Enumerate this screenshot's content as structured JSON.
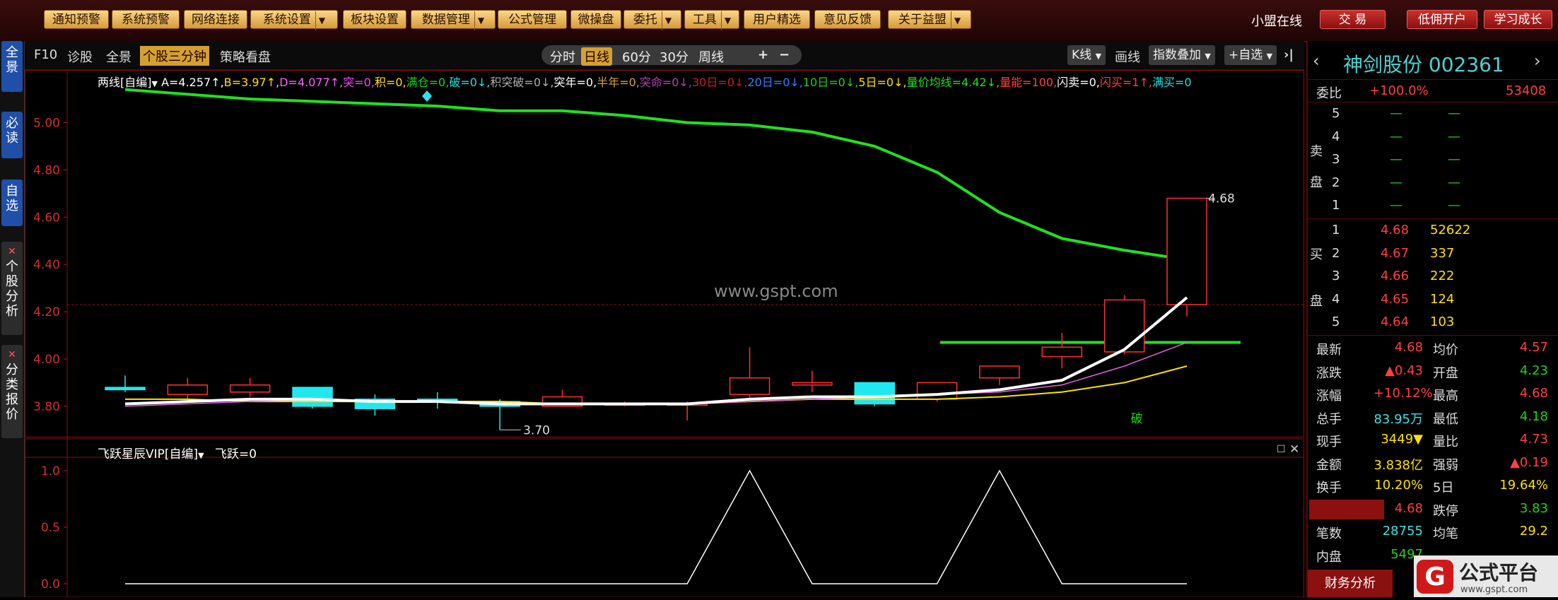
{
  "toolbar": {
    "buttons": [
      {
        "label": "通知预警",
        "dropdown": false
      },
      {
        "label": "系统预警",
        "dropdown": false
      },
      {
        "label": "网络连接",
        "dropdown": false
      },
      {
        "label": "系统设置",
        "dropdown": true
      },
      {
        "label": "板块设置",
        "dropdown": false
      },
      {
        "label": "数据管理",
        "dropdown": true
      },
      {
        "label": "公式管理",
        "dropdown": false
      },
      {
        "label": "微操盘",
        "dropdown": false
      },
      {
        "label": "委托",
        "dropdown": true
      },
      {
        "label": "工具",
        "dropdown": true
      },
      {
        "label": "用户精选",
        "dropdown": false
      },
      {
        "label": "意见反馈",
        "dropdown": false
      },
      {
        "label": "关于益盟",
        "dropdown": true
      }
    ],
    "online_label": "小盟在线",
    "right_buttons": [
      "交 易",
      "低佣开户",
      "学习成长"
    ]
  },
  "left_tabs": [
    "全景",
    "必读",
    "自选",
    "个股分析",
    "分类报价"
  ],
  "chart_toolbar": {
    "left_items": [
      "F10",
      "诊股",
      "全景",
      "个股三分钟",
      "策略看盘"
    ],
    "periods": [
      "分时",
      "日线",
      "60分",
      "30分",
      "周线"
    ],
    "zoom": [
      "+",
      "−"
    ],
    "right_items": [
      "K线",
      "画线",
      "指数叠加",
      "+自选"
    ],
    "close_label": "›|"
  },
  "indicator_main": {
    "name": "两线[自编]",
    "parts": [
      {
        "t": "A=4.257↑,",
        "c": "#ffffff"
      },
      {
        "t": "B=3.97↑,",
        "c": "#ffe000"
      },
      {
        "t": "D=4.077↑,",
        "c": "#ff60ff"
      },
      {
        "t": "突=0,",
        "c": "#ff40ff"
      },
      {
        "t": "积=0,",
        "c": "#ffe000"
      },
      {
        "t": "满仓=0,",
        "c": "#20d020"
      },
      {
        "t": "破=0↓,",
        "c": "#20e0e0"
      },
      {
        "t": "积突破=0↓,",
        "c": "#aaaaaa"
      },
      {
        "t": "突年=0,",
        "c": "#ffffff"
      },
      {
        "t": "半年=0,",
        "c": "#d0a040"
      },
      {
        "t": "突命=0↓,",
        "c": "#b040b0"
      },
      {
        "t": "30日=0↓,",
        "c": "#c02020"
      },
      {
        "t": "20日=0↓,",
        "c": "#3080ff"
      },
      {
        "t": "10日=0↓,",
        "c": "#20d020"
      },
      {
        "t": "5日=0↓,",
        "c": "#ffe000"
      },
      {
        "t": "量价均线=4.42↓,",
        "c": "#20e020"
      },
      {
        "t": "量能=100,",
        "c": "#ff4040"
      },
      {
        "t": "闪卖=0,",
        "c": "#ffffff"
      },
      {
        "t": "闪买=1↑,",
        "c": "#ff4040"
      },
      {
        "t": "满买=0",
        "c": "#20e0e0"
      }
    ]
  },
  "indicator_sub": {
    "name": "飞跃星辰VIP[自编]",
    "value": "飞跃=0"
  },
  "watermark": "www.gspt.com",
  "chart_data": {
    "type": "candlestick",
    "y_ticks": [
      "5.00",
      "4.80",
      "4.60",
      "4.40",
      "4.20",
      "4.00",
      "3.80"
    ],
    "ylim": [
      3.68,
      5.16
    ],
    "label_high": "4.68",
    "label_low": "3.70",
    "marker_label": "破",
    "candles": [
      {
        "o": 3.88,
        "h": 3.93,
        "l": 3.86,
        "c": 3.87
      },
      {
        "o": 3.85,
        "h": 3.92,
        "l": 3.83,
        "c": 3.89
      },
      {
        "o": 3.86,
        "h": 3.92,
        "l": 3.84,
        "c": 3.89
      },
      {
        "o": 3.88,
        "h": 3.88,
        "l": 3.79,
        "c": 3.8
      },
      {
        "o": 3.83,
        "h": 3.85,
        "l": 3.76,
        "c": 3.79
      },
      {
        "o": 3.83,
        "h": 3.86,
        "l": 3.79,
        "c": 3.82
      },
      {
        "o": 3.82,
        "h": 3.83,
        "l": 3.7,
        "c": 3.8
      },
      {
        "o": 3.8,
        "h": 3.87,
        "l": 3.8,
        "c": 3.84
      },
      {
        "o": 3.81,
        "h": 3.82,
        "l": 3.8,
        "c": 3.81
      },
      {
        "o": 3.81,
        "h": 3.82,
        "l": 3.74,
        "c": 3.81
      },
      {
        "o": 3.85,
        "h": 4.05,
        "l": 3.83,
        "c": 3.92
      },
      {
        "o": 3.89,
        "h": 3.95,
        "l": 3.86,
        "c": 3.9
      },
      {
        "o": 3.9,
        "h": 3.9,
        "l": 3.8,
        "c": 3.81
      },
      {
        "o": 3.83,
        "h": 3.9,
        "l": 3.82,
        "c": 3.9
      },
      {
        "o": 3.92,
        "h": 3.97,
        "l": 3.89,
        "c": 3.97
      },
      {
        "o": 4.01,
        "h": 4.11,
        "l": 3.96,
        "c": 4.05
      },
      {
        "o": 4.03,
        "h": 4.27,
        "l": 4.02,
        "c": 4.25
      },
      {
        "o": 4.23,
        "h": 4.68,
        "l": 4.18,
        "c": 4.68
      }
    ],
    "ma_white": [
      3.81,
      3.82,
      3.83,
      3.83,
      3.82,
      3.82,
      3.81,
      3.81,
      3.81,
      3.81,
      3.83,
      3.84,
      3.84,
      3.85,
      3.87,
      3.91,
      4.04,
      4.26
    ],
    "ma_yellow": [
      3.83,
      3.83,
      3.82,
      3.82,
      3.82,
      3.82,
      3.82,
      3.81,
      3.81,
      3.81,
      3.82,
      3.83,
      3.83,
      3.83,
      3.84,
      3.86,
      3.9,
      3.97
    ],
    "ma_pink": [
      3.8,
      3.81,
      3.82,
      3.83,
      3.82,
      3.82,
      3.81,
      3.81,
      3.81,
      3.81,
      3.82,
      3.83,
      3.84,
      3.85,
      3.86,
      3.89,
      3.97,
      4.07
    ],
    "green_long": [
      5.14,
      5.12,
      5.1,
      5.09,
      5.08,
      5.07,
      5.05,
      5.05,
      5.03,
      5.0,
      4.99,
      4.96,
      4.9,
      4.79,
      4.62,
      4.51,
      4.46,
      4.42
    ],
    "support_level": 4.07,
    "sub_ylim": [
      0,
      1
    ],
    "sub_ticks": [
      "1.0",
      "0.5",
      "0.0"
    ],
    "sub_values": [
      0,
      0,
      0,
      0,
      0,
      0,
      0,
      0,
      0,
      0,
      1,
      0,
      0,
      0,
      1,
      0,
      0,
      0
    ]
  },
  "quote": {
    "name": "神剑股份",
    "code": "002361",
    "ratio_label": "委比",
    "ratio_value": "+100.0%",
    "ratio_diff": "53408",
    "sell_label": [
      "卖",
      "盘"
    ],
    "buy_label": [
      "买",
      "盘"
    ],
    "sell": [
      {
        "lv": "5",
        "p": "—",
        "v": "—"
      },
      {
        "lv": "4",
        "p": "—",
        "v": "—"
      },
      {
        "lv": "3",
        "p": "—",
        "v": "—"
      },
      {
        "lv": "2",
        "p": "—",
        "v": "—"
      },
      {
        "lv": "1",
        "p": "—",
        "v": "—"
      }
    ],
    "buy": [
      {
        "lv": "1",
        "p": "4.68",
        "v": "52622"
      },
      {
        "lv": "2",
        "p": "4.67",
        "v": "337"
      },
      {
        "lv": "3",
        "p": "4.66",
        "v": "222"
      },
      {
        "lv": "4",
        "p": "4.65",
        "v": "124"
      },
      {
        "lv": "5",
        "p": "4.64",
        "v": "103"
      }
    ],
    "stats": [
      {
        "l1": "最新",
        "v1": "4.68",
        "c1": "red",
        "l2": "均价",
        "v2": "4.57",
        "c2": "red"
      },
      {
        "l1": "涨跌",
        "v1": "▲0.43",
        "c1": "red",
        "l2": "开盘",
        "v2": "4.23",
        "c2": "grn"
      },
      {
        "l1": "涨幅",
        "v1": "+10.12%",
        "c1": "red",
        "l2": "最高",
        "v2": "4.68",
        "c2": "red"
      },
      {
        "l1": "总手",
        "v1": "83.95万",
        "c1": "cyn",
        "l2": "最低",
        "v2": "4.18",
        "c2": "grn"
      },
      {
        "l1": "现手",
        "v1": "3449▼",
        "c1": "yel",
        "l2": "量比",
        "v2": "4.73",
        "c2": "red"
      },
      {
        "l1": "金额",
        "v1": "3.838亿",
        "c1": "yel",
        "l2": "强弱",
        "v2": "▲0.19",
        "c2": "red"
      },
      {
        "l1": "换手",
        "v1": "10.20%",
        "c1": "yel",
        "l2": "5日",
        "v2": "19.64%",
        "c2": "yel"
      },
      {
        "l1": "涨停",
        "v1": "4.68",
        "c1": "red",
        "l2": "跌停",
        "v2": "3.83",
        "c2": "grn"
      },
      {
        "l1": "笔数",
        "v1": "28755",
        "c1": "cyn",
        "l2": "均笔",
        "v2": "29.2",
        "c2": "yel"
      },
      {
        "l1": "内盘",
        "v1": "5497",
        "c1": "grn",
        "l2": "",
        "v2": "",
        "c2": "grn"
      }
    ],
    "fin_button": "财务分析",
    "logo_text": "公式平台",
    "logo_url": "www.gspt.com"
  }
}
